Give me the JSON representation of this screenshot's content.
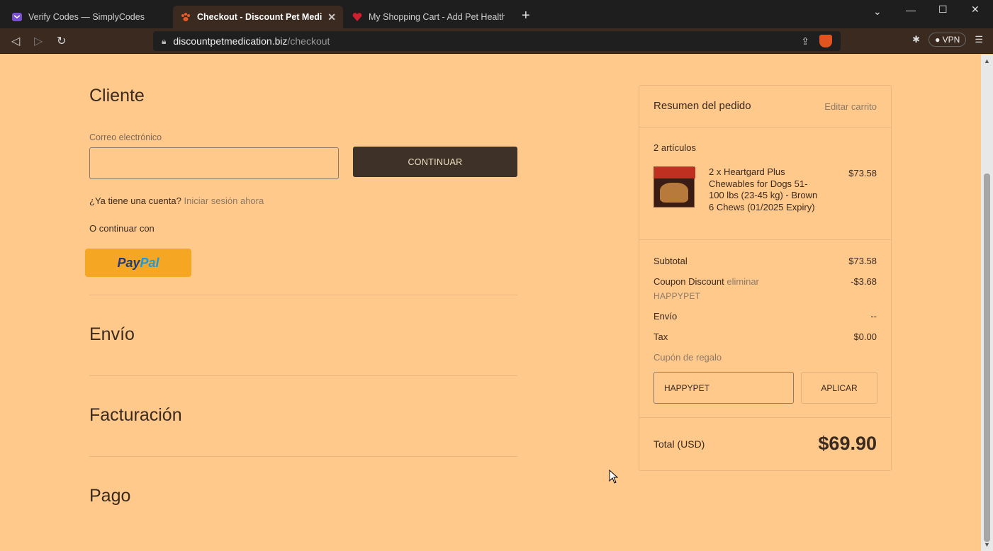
{
  "browser": {
    "tabs": [
      {
        "title": "Verify Codes — SimplyCodes",
        "icon": "simplycodes-icon"
      },
      {
        "title": "Checkout - Discount Pet Medicati",
        "icon": "paw-icon",
        "active": true
      },
      {
        "title": "My Shopping Cart - Add Pet Health Pr",
        "icon": "pet-health-icon"
      }
    ],
    "url_domain": "discountpetmedication.biz",
    "url_path": "/checkout",
    "vpn_label": "VPN"
  },
  "checkout": {
    "customer_title": "Cliente",
    "email_label": "Correo electrónico",
    "email_value": "",
    "continue_label": "CONTINUAR",
    "account_prompt": "¿Ya tiene una cuenta?",
    "signin_link": "Iniciar sesión ahora",
    "or_continue": "O continuar con",
    "paypal_pay": "Pay",
    "paypal_pal": "Pal",
    "shipping_title": "Envío",
    "billing_title": "Facturación",
    "payment_title": "Pago"
  },
  "summary": {
    "title": "Resumen del pedido",
    "edit_cart": "Editar carrito",
    "items_count": "2 artículos",
    "product_name": "2 x Heartgard Plus Chewables for Dogs 51-100 lbs (23-45 kg) - Brown 6 Chews (01/2025 Expiry)",
    "product_price": "$73.58",
    "subtotal_label": "Subtotal",
    "subtotal_value": "$73.58",
    "coupon_label": "Coupon Discount",
    "coupon_remove": "eliminar",
    "coupon_code": "HAPPYPET",
    "coupon_value": "-$3.68",
    "shipping_label": "Envío",
    "shipping_value": "--",
    "tax_label": "Tax",
    "tax_value": "$0.00",
    "gift_link": "Cupón de regalo",
    "gift_input_value": "HAPPYPET",
    "apply_label": "APLICAR",
    "total_label": "Total (USD)",
    "total_value": "$69.90"
  }
}
